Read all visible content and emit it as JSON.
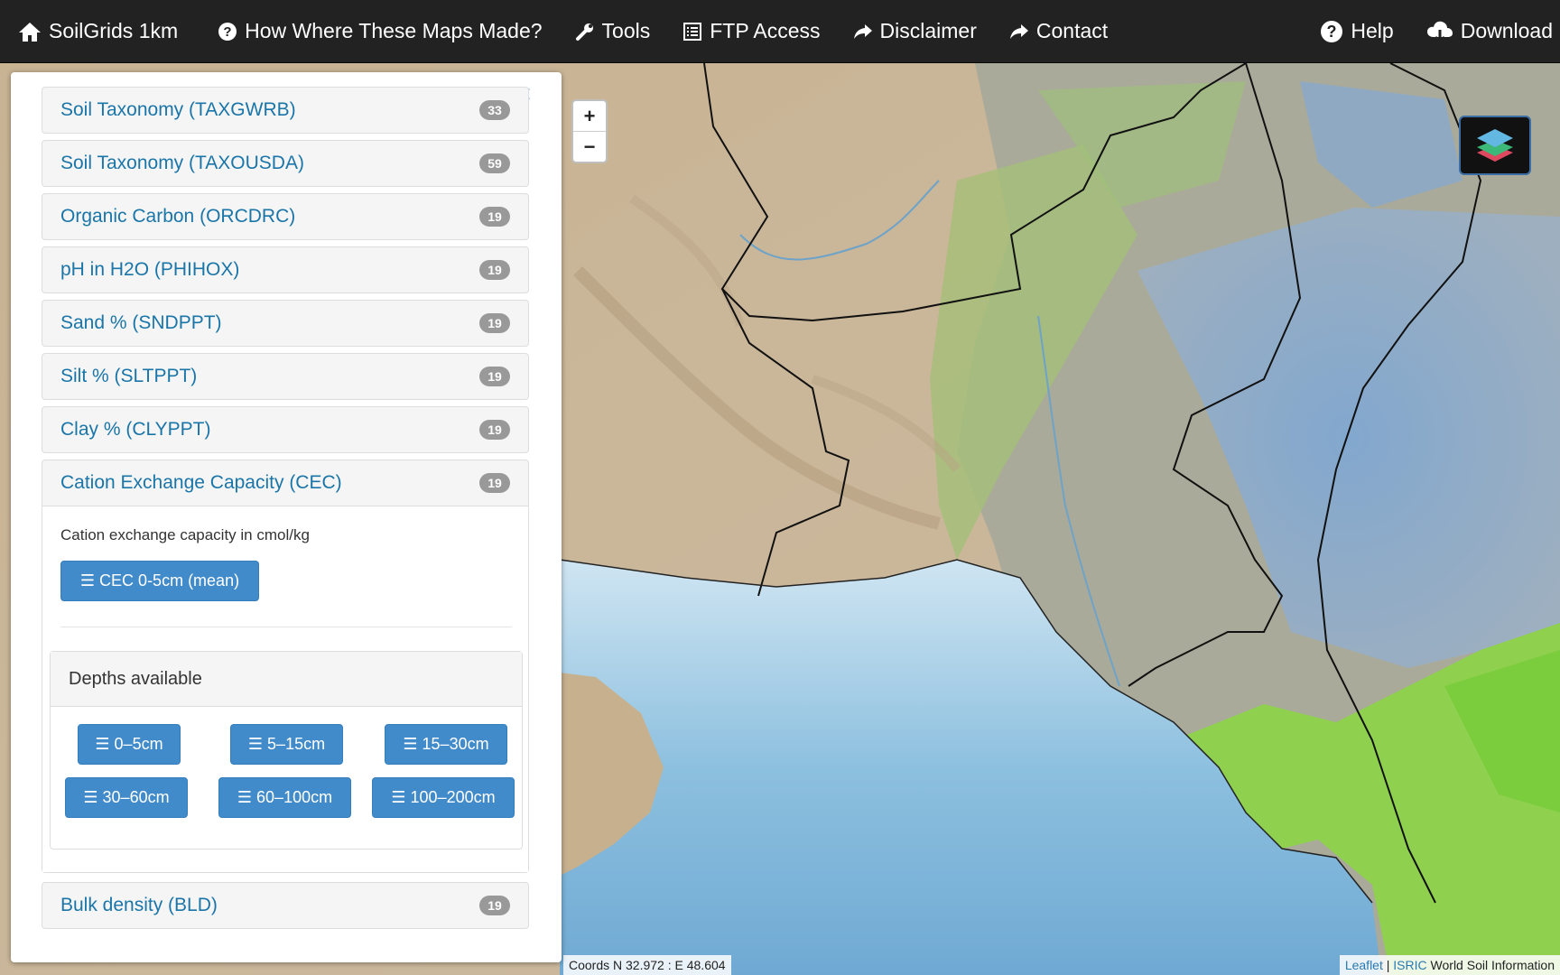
{
  "nav": {
    "brand": "SoilGrids 1km",
    "how": "How Where These Maps Made?",
    "tools": "Tools",
    "ftp": "FTP Access",
    "disclaimer": "Disclaimer",
    "contact": "Contact",
    "help": "Help",
    "download": "Download"
  },
  "sidebar": {
    "close": "×",
    "panels": [
      {
        "title": "Soil Taxonomy (TAXGWRB)",
        "count": "33"
      },
      {
        "title": "Soil Taxonomy (TAXOUSDA)",
        "count": "59"
      },
      {
        "title": "Organic Carbon (ORCDRC)",
        "count": "19"
      },
      {
        "title": "pH in H2O (PHIHOX)",
        "count": "19"
      },
      {
        "title": "Sand % (SNDPPT)",
        "count": "19"
      },
      {
        "title": "Silt % (SLTPPT)",
        "count": "19"
      },
      {
        "title": "Clay % (CLYPPT)",
        "count": "19"
      },
      {
        "title": "Cation Exchange Capacity (CEC)",
        "count": "19"
      },
      {
        "title": "Bulk density (BLD)",
        "count": "19"
      }
    ],
    "open_panel": {
      "description": "Cation exchange capacity in cmol/kg",
      "main_button": "CEC 0-5cm (mean)",
      "depths_title": "Depths available",
      "depths": [
        "0–5cm",
        "5–15cm",
        "15–30cm",
        "30–60cm",
        "60–100cm",
        "100–200cm"
      ]
    }
  },
  "map": {
    "zoom_in": "+",
    "zoom_out": "−",
    "coords": "Coords N 32.972 : E 48.604",
    "attribution_leaflet": "Leaflet",
    "attribution_sep": "|",
    "attribution_isric": "ISRIC",
    "attribution_rest": "World Soil Information"
  },
  "colors": {
    "navbar": "#222222",
    "link": "#1a75a8",
    "button": "#428bca",
    "badge": "#999999"
  }
}
